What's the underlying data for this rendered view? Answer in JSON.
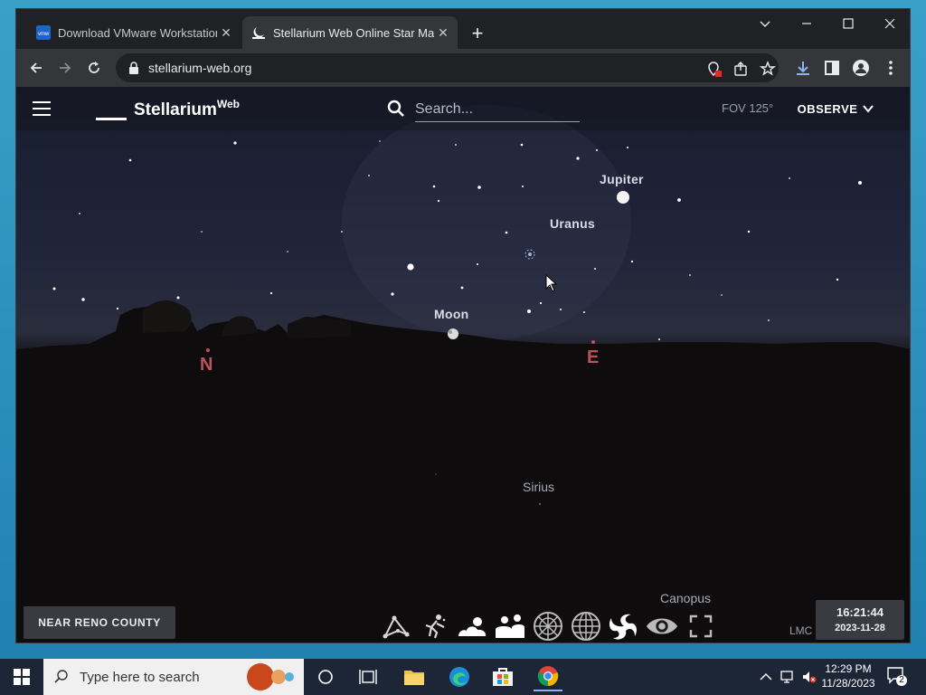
{
  "browser": {
    "tabs": [
      {
        "title": "Download VMware Workstation",
        "active": false,
        "favicon": "vmware-icon"
      },
      {
        "title": "Stellarium Web Online Star Map",
        "active": true,
        "favicon": "stellarium-moon-icon"
      }
    ],
    "url": "stellarium-web.org"
  },
  "app": {
    "brand": "Stellarium",
    "brand_sup": "Web",
    "search_placeholder": "Search...",
    "fov": "FOV 125°",
    "observe_label": "OBSERVE"
  },
  "sky": {
    "labels": [
      {
        "name": "Jupiter"
      },
      {
        "name": "Uranus"
      },
      {
        "name": "Moon"
      },
      {
        "name": "Sirius"
      },
      {
        "name": "Canopus"
      }
    ],
    "cardinals": {
      "north": "N",
      "east": "E"
    }
  },
  "bottom": {
    "location": "NEAR RENO COUNTY",
    "lmc": "LMC",
    "time": "16:21:44",
    "date": "2023-11-28",
    "tools": [
      "constellation-lines-icon",
      "constellation-art-icon",
      "atmosphere-icon",
      "landscape-icon",
      "azimuthal-grid-icon",
      "equatorial-grid-icon",
      "deep-sky-objects-icon",
      "night-mode-icon",
      "fullscreen-icon"
    ]
  },
  "taskbar": {
    "search_placeholder": "Type here to search",
    "clock_time": "12:29 PM",
    "clock_date": "11/28/2023",
    "notification_count": "2"
  },
  "colors": {
    "cardinal": "#c0505a",
    "accent_blue": "#8ab4f8"
  }
}
